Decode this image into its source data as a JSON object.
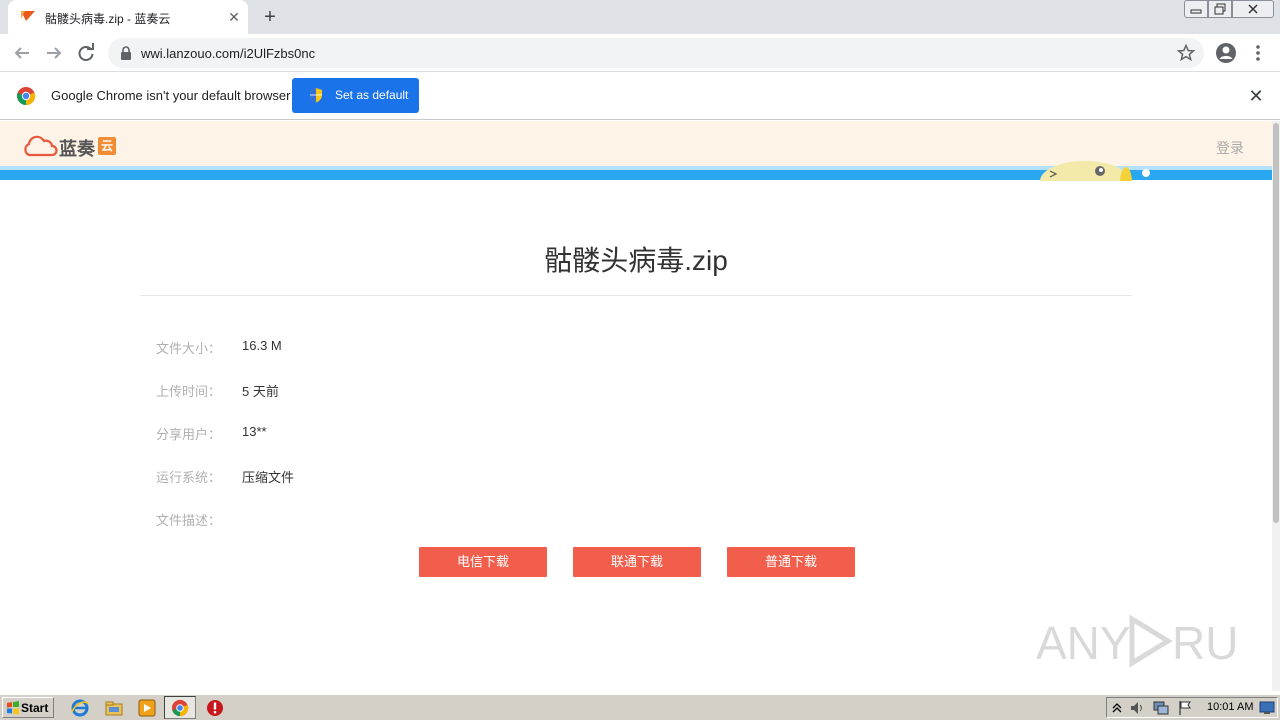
{
  "browser": {
    "tab": {
      "title": "骷髅头病毒.zip - 蓝奏云"
    },
    "url": "wwi.lanzouo.com/i2UlFzbs0nc"
  },
  "infobar": {
    "message": "Google Chrome isn't your default browser",
    "button_label": "Set as default"
  },
  "site": {
    "logo_text": "蓝奏",
    "logo_badge": "云",
    "login_label": "登录"
  },
  "file": {
    "title": "骷髅头病毒.zip",
    "info": [
      {
        "label": "文件大小：",
        "value": "16.3 M"
      },
      {
        "label": "上传时间：",
        "value": "5 天前"
      },
      {
        "label": "分享用户：",
        "value": "13**"
      },
      {
        "label": "运行系统：",
        "value": "压缩文件"
      },
      {
        "label": "文件描述：",
        "value": ""
      }
    ]
  },
  "downloads": [
    {
      "label": "电信下载"
    },
    {
      "label": "联通下载"
    },
    {
      "label": "普通下载"
    }
  ],
  "colors": {
    "download_button": "#f25e4c",
    "banner": "#2aa7f1",
    "header_bg": "#fdf3e6",
    "chrome_blue": "#1a73e8"
  },
  "watermark": "ANY RUN",
  "taskbar": {
    "start_label": "Start",
    "clock": "10:01 AM"
  }
}
